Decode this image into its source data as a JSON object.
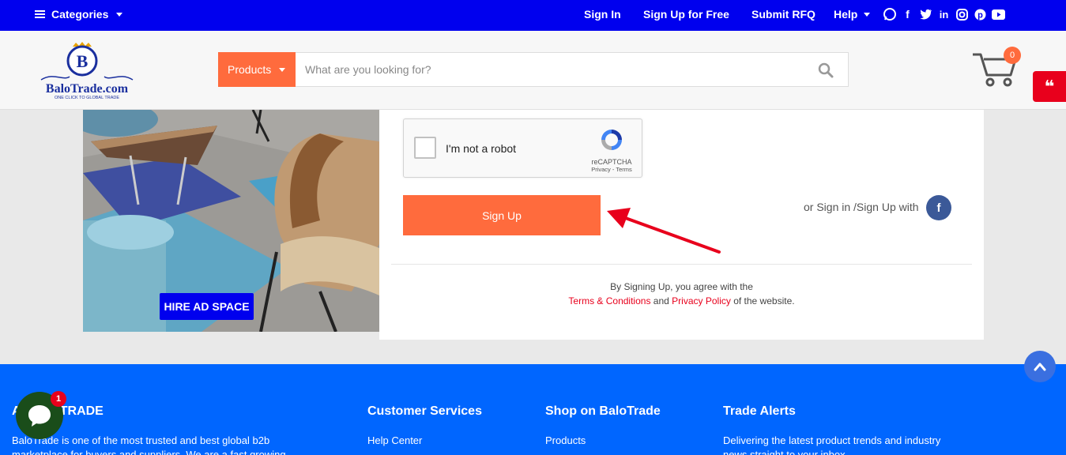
{
  "topbar": {
    "categories_label": "Categories",
    "links": {
      "sign_in": "Sign In",
      "sign_up": "Sign Up for Free",
      "submit_rfq": "Submit RFQ",
      "help": "Help"
    },
    "social_icons": [
      "whatsapp-icon",
      "facebook-icon",
      "twitter-icon",
      "linkedin-icon",
      "instagram-icon",
      "pinterest-icon",
      "youtube-icon"
    ]
  },
  "header": {
    "logo": {
      "letter": "B",
      "brand": "BaloTrade.com",
      "tagline": "ONE CLICK TO GLOBAL TRADE"
    },
    "search": {
      "category": "Products",
      "placeholder": "What are you looking for?"
    },
    "cart_count": "0"
  },
  "ad": {
    "hire_label": "HIRE AD SPACE"
  },
  "signup_form": {
    "captcha": {
      "label": "I'm not a robot",
      "brand": "reCAPTCHA",
      "links": "Privacy - Terms"
    },
    "signup_button": "Sign Up",
    "alt_signin": "or Sign in /Sign Up with",
    "terms_line1": "By Signing Up, you agree with the",
    "terms_link": "Terms & Conditions",
    "and": "and",
    "privacy_link": "Privacy Policy",
    "terms_suffix": "of the website."
  },
  "footer": {
    "about_heading_visible": "A        BALOTRADE",
    "about_text": "BaloTrade is one of the most trusted and best global b2b",
    "about_text2": "marketplace for buyers and suppliers. We are a fast growing",
    "customer_services": "Customer Services",
    "help_center": "Help Center",
    "shop_heading": "Shop on BaloTrade",
    "products": "Products",
    "trade_alerts": "Trade Alerts",
    "trade_text": "Delivering the latest product trends and industry",
    "trade_text2": "news straight to your inbox."
  },
  "chat_badge": "1",
  "colors": {
    "topbar": "#0000ee",
    "accent": "#ff6b3d",
    "footer": "#0066ff",
    "link_red": "#e8001c"
  }
}
